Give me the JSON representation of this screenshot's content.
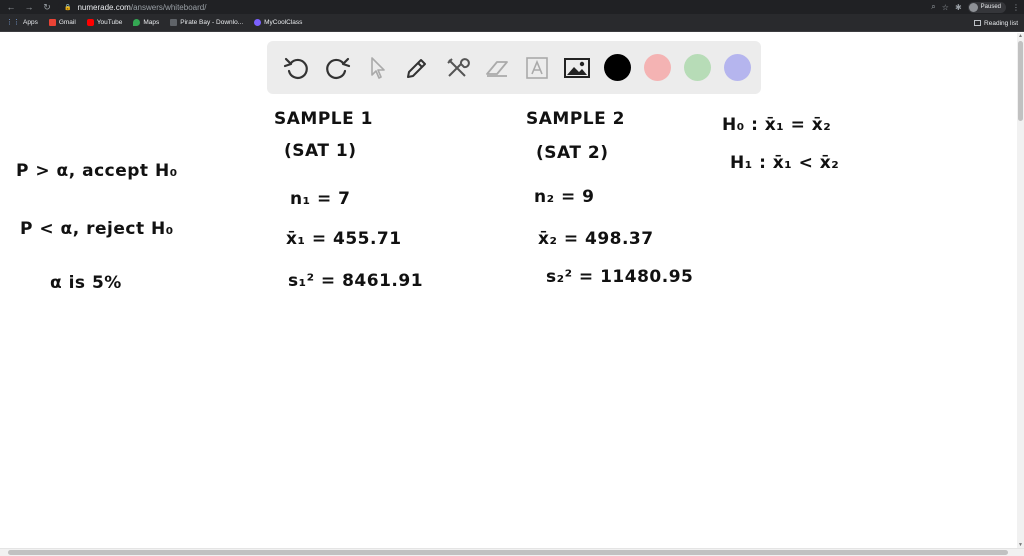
{
  "browser": {
    "url_host": "numerade.com",
    "url_path": "/answers/whiteboard/",
    "profile_status": "Paused",
    "bookmarks": [
      {
        "label": "Apps"
      },
      {
        "label": "Gmail"
      },
      {
        "label": "YouTube"
      },
      {
        "label": "Maps"
      },
      {
        "label": "Pirate Bay - Downlo..."
      },
      {
        "label": "MyCoolClass"
      }
    ],
    "reading_list": "Reading list"
  },
  "toolbar": {
    "tools": [
      "undo-icon",
      "redo-icon",
      "pointer-icon",
      "pencil-icon",
      "tools-icon",
      "eraser-icon",
      "text-icon",
      "image-icon"
    ],
    "colors": [
      "#000000",
      "#f4b3b3",
      "#b7dcb7",
      "#b5b5ee"
    ]
  },
  "board": {
    "notes": {
      "accept_rule": "P > α, accept H₀",
      "reject_rule": "P < α, reject H₀",
      "alpha": "α is 5%"
    },
    "sample1": {
      "title": "SAMPLE 1",
      "subtitle": "(SAT 1)",
      "n": "n₁ = 7",
      "mean": "x̄₁ = 455.71",
      "variance": "s₁² = 8461.91"
    },
    "sample2": {
      "title": "SAMPLE 2",
      "subtitle": "(SAT 2)",
      "n": "n₂ = 9",
      "mean": "x̄₂ = 498.37",
      "variance": "s₂² = 11480.95"
    },
    "hypotheses": {
      "h0": "H₀ : x̄₁ = x̄₂",
      "h1": "H₁ : x̄₁ < x̄₂"
    }
  }
}
